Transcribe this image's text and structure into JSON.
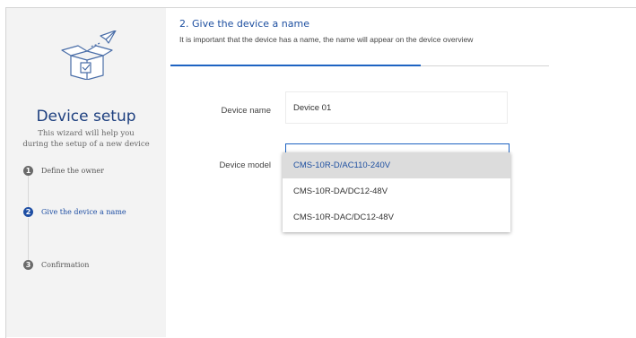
{
  "sidebar": {
    "title": "Device setup",
    "subtitle_line1": "This wizard will help you",
    "subtitle_line2": "during the setup of a new device",
    "steps": [
      {
        "number": "1",
        "label": "Define the owner"
      },
      {
        "number": "2",
        "label": "Give the device a name"
      },
      {
        "number": "3",
        "label": "Confirmation"
      }
    ],
    "active_step": 2
  },
  "main": {
    "heading": "2. Give the device a name",
    "subheading": "It is important that the device has a name, the name will appear on the device overview",
    "progress_fraction": 0.66,
    "device_name": {
      "label": "Device name",
      "value": "Device 01"
    },
    "device_model": {
      "label": "Device model",
      "options": [
        "CMS-10R-D/AC110-240V",
        "CMS-10R-DA/DC12-48V",
        "CMS-10R-DAC/DC12-48V"
      ],
      "highlighted_index": 0
    }
  },
  "colors": {
    "accent": "#1e4ea3",
    "progress": "#1e63c2",
    "sidebar_bg": "#f3f3f3",
    "title": "#1d3f7f"
  },
  "icons": {
    "logo": "open-box-with-paper-plane-icon"
  }
}
